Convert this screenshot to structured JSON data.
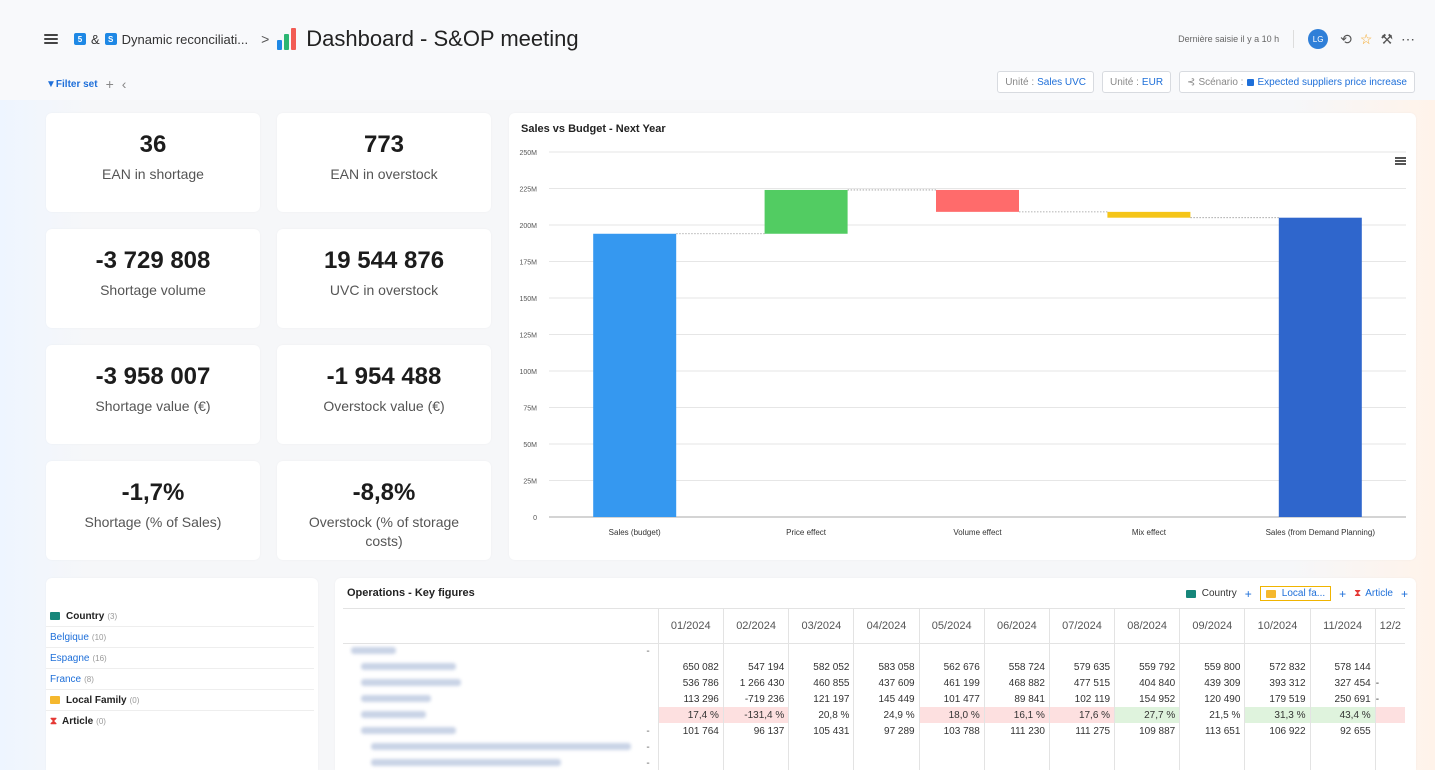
{
  "header": {
    "breadcrumb_sep": "&",
    "app_badge_a": "5",
    "app_badge_b": "S",
    "breadcrumb": "Dynamic reconciliati...",
    "chevron": ">",
    "title": "Dashboard - S&OP meeting",
    "last_entry": "Dernière saisie il y a 10 h",
    "avatar": "LG"
  },
  "filterbar": {
    "filter_label": "▼Filter set",
    "unit_sales_label": "Unité :",
    "unit_sales_value": "Sales UVC",
    "unit_eur_label": "Unité :",
    "unit_eur_value": "EUR",
    "scenario_label": "Scénario :",
    "scenario_value": "Expected suppliers price increase"
  },
  "kpis": [
    {
      "value": "36",
      "label": "EAN in shortage"
    },
    {
      "value": "773",
      "label": "EAN in overstock"
    },
    {
      "value": "-3 729 808",
      "label": "Shortage volume"
    },
    {
      "value": "19 544 876",
      "label": "UVC in overstock"
    },
    {
      "value": "-3 958 007",
      "label": "Shortage value (€)"
    },
    {
      "value": "-1 954 488",
      "label": "Overstock value (€)"
    },
    {
      "value": "-1,7%",
      "label": "Shortage (% of Sales)"
    },
    {
      "value": "-8,8%",
      "label": "Overstock (% of storage costs)"
    }
  ],
  "chart_data": {
    "type": "bar",
    "title": "Sales vs Budget - Next Year",
    "categories": [
      "Sales (budget)",
      "Price effect",
      "Volume effect",
      "Mix effect",
      "Sales (from Demand Planning)"
    ],
    "bars": [
      {
        "base": 0,
        "top": 194,
        "color": "#3598f0"
      },
      {
        "base": 194,
        "top": 224,
        "color": "#52cc62"
      },
      {
        "base": 209,
        "top": 224,
        "color": "#ff6b6b"
      },
      {
        "base": 205,
        "top": 209,
        "color": "#f5c518"
      },
      {
        "base": 0,
        "top": 205,
        "color": "#2f66cc"
      }
    ],
    "yticks": [
      "0",
      "25M",
      "50M",
      "75M",
      "100M",
      "125M",
      "150M",
      "175M",
      "200M",
      "225M",
      "250M"
    ],
    "ylim": [
      0,
      250
    ],
    "unit": "M"
  },
  "sidebar": {
    "country_label": "Country",
    "country_count": "(3)",
    "countries": [
      {
        "name": "Belgique",
        "count": "(10)"
      },
      {
        "name": "Espagne",
        "count": "(16)"
      },
      {
        "name": "France",
        "count": "(8)"
      }
    ],
    "family_label": "Local Family",
    "family_count": "(0)",
    "article_label": "Article",
    "article_count": "(0)"
  },
  "operations": {
    "title": "Operations - Key figures",
    "tool_country": "Country",
    "tool_family": "Local fa...",
    "tool_article": "Article",
    "plus": "+",
    "months": [
      "01/2024",
      "02/2024",
      "03/2024",
      "04/2024",
      "05/2024",
      "06/2024",
      "07/2024",
      "08/2024",
      "09/2024",
      "10/2024",
      "11/2024",
      "12/2"
    ],
    "rows": [
      {
        "cells": [
          "650 082",
          "547 194",
          "582 052",
          "583 058",
          "562 676",
          "558 724",
          "579 635",
          "559 792",
          "559 800",
          "572 832",
          "578 144",
          ""
        ]
      },
      {
        "cells": [
          "536 786",
          "1 266 430",
          "460 855",
          "437 609",
          "461 199",
          "468 882",
          "477 515",
          "404 840",
          "439 309",
          "393 312",
          "327 454",
          "-"
        ]
      },
      {
        "cells": [
          "113 296",
          "-719 236",
          "121 197",
          "145 449",
          "101 477",
          "89 841",
          "102 119",
          "154 952",
          "120 490",
          "179 519",
          "250 691",
          "-"
        ]
      },
      {
        "cells": [
          "17,4 %",
          "-131,4 %",
          "20,8 %",
          "24,9 %",
          "18,0 %",
          "16,1 %",
          "17,6 %",
          "27,7 %",
          "21,5 %",
          "31,3 %",
          "43,4 %",
          ""
        ],
        "status": [
          "r",
          "r",
          "",
          "",
          "r",
          "r",
          "r",
          "g",
          "",
          "g",
          "g",
          "r"
        ]
      },
      {
        "cells": [
          "101 764",
          "96 137",
          "105 431",
          "97 289",
          "103 788",
          "111 230",
          "111 275",
          "109 887",
          "113 651",
          "106 922",
          "92 655",
          ""
        ]
      }
    ],
    "dash": "-"
  }
}
